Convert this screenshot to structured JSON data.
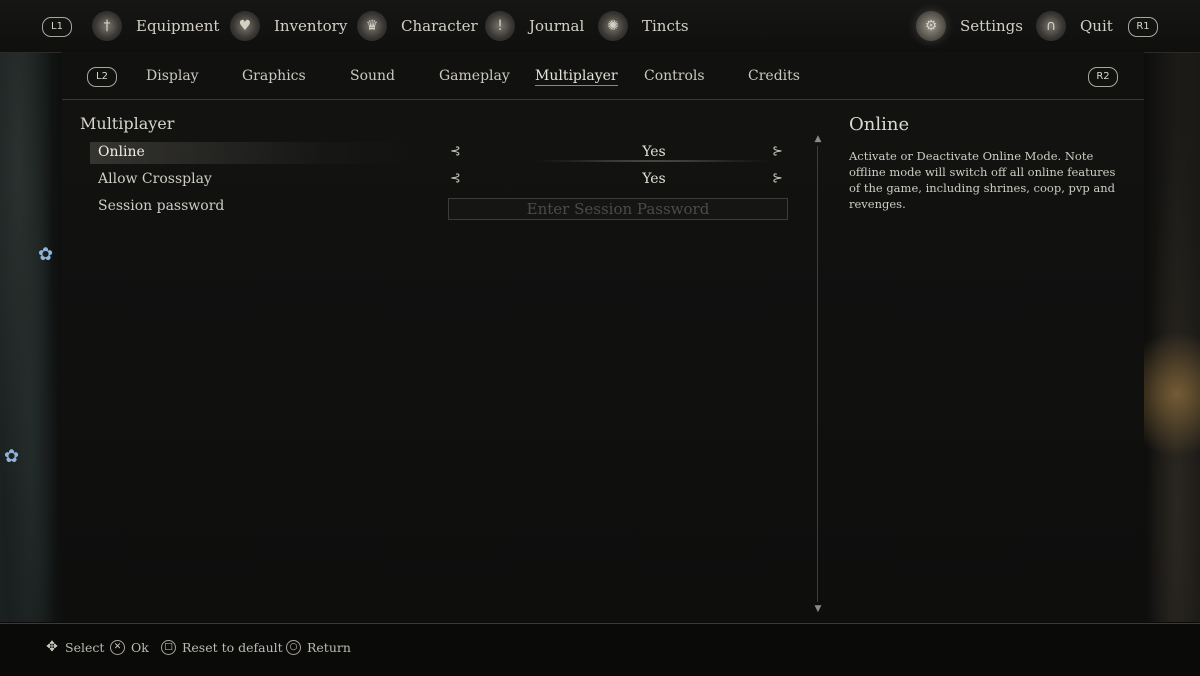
{
  "topnav": {
    "left_bumper": "L1",
    "right_bumper": "R1",
    "items": [
      {
        "label": "Equipment",
        "icon": "sword-icon"
      },
      {
        "label": "Inventory",
        "icon": "heart-icon"
      },
      {
        "label": "Character",
        "icon": "crown-icon"
      },
      {
        "label": "Journal",
        "icon": "candle-icon"
      },
      {
        "label": "Tincts",
        "icon": "lamp-icon"
      },
      {
        "label": "Settings",
        "icon": "gear-icon"
      },
      {
        "label": "Quit",
        "icon": "archway-icon"
      }
    ],
    "active": "Settings"
  },
  "subtabs": {
    "left_trigger": "L2",
    "right_trigger": "R2",
    "items": [
      "Display",
      "Graphics",
      "Sound",
      "Gameplay",
      "Multiplayer",
      "Controls",
      "Credits"
    ],
    "active": "Multiplayer"
  },
  "section": {
    "title": "Multiplayer"
  },
  "settings": [
    {
      "label": "Online",
      "value": "Yes",
      "selected": true
    },
    {
      "label": "Allow Crossplay",
      "value": "Yes",
      "selected": false
    },
    {
      "label": "Session password",
      "value": "",
      "placeholder": "Enter Session Password"
    }
  ],
  "description": {
    "title": "Online",
    "text": "Activate or Deactivate Online Mode. Note offline mode will switch off all online features of the game, including shrines, coop, pvp and revenges."
  },
  "bottom_hints": [
    {
      "icon": "dpad-icon",
      "label": "Select"
    },
    {
      "icon": "cross-button-icon",
      "label": "Ok"
    },
    {
      "icon": "square-button-icon",
      "label": "Reset to default"
    },
    {
      "icon": "circle-button-icon",
      "label": "Return"
    }
  ],
  "colors": {
    "background": "#0b0b0a",
    "text": "#c9c6bd",
    "accent_flower": "#8fb4d8",
    "candle": "#d2a050"
  }
}
